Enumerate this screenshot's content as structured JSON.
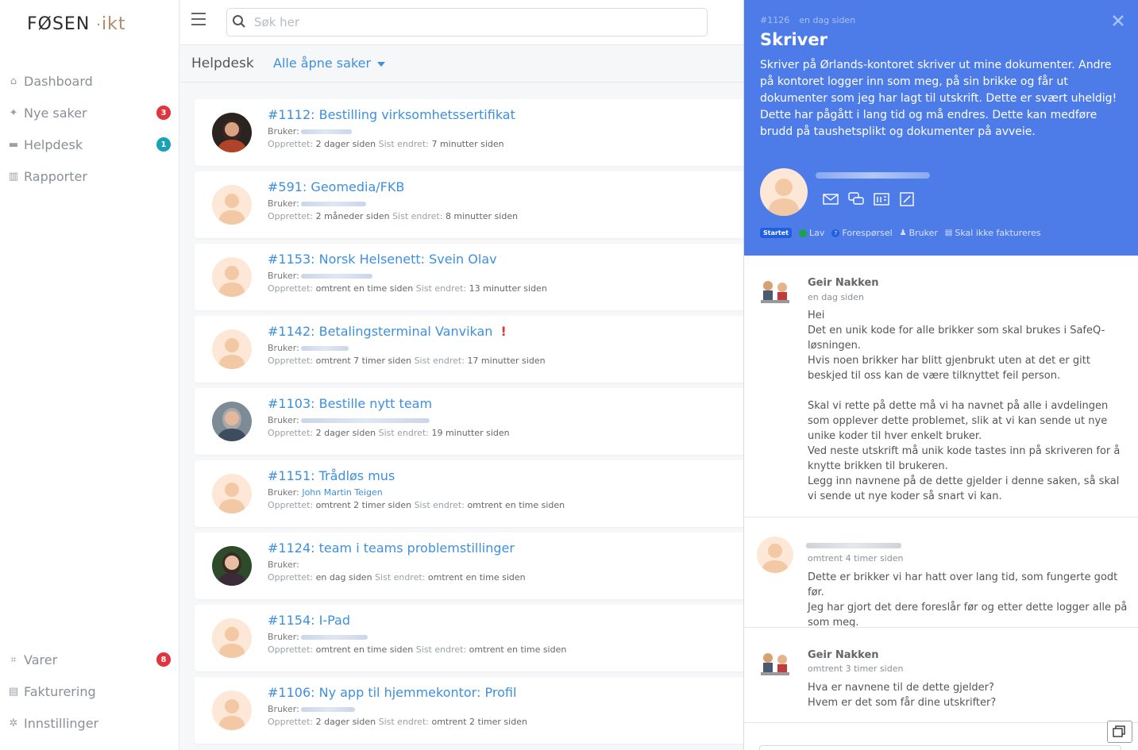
{
  "app": {
    "logo_main": "FØSEN",
    "logo_suffix": "ikt"
  },
  "sidebar": {
    "items": [
      {
        "label": "Dashboard",
        "icon": "home-icon"
      },
      {
        "label": "Nye saker",
        "icon": "sparkle-icon",
        "badge": "3",
        "badge_color": "#e0343f"
      },
      {
        "label": "Helpdesk",
        "icon": "monitor-icon",
        "badge": "1",
        "badge_color": "#17a2b8"
      },
      {
        "label": "Rapporter",
        "icon": "chart-icon"
      }
    ],
    "bottom_items": [
      {
        "label": "Varer",
        "icon": "gift-icon",
        "badge": "8",
        "badge_color": "#e0343f"
      },
      {
        "label": "Fakturering",
        "icon": "invoice-icon"
      },
      {
        "label": "Innstillinger",
        "icon": "gear-icon"
      }
    ]
  },
  "search": {
    "placeholder": "Søk her"
  },
  "subheader": {
    "title": "Helpdesk",
    "filter": "Alle åpne saker"
  },
  "tickets": [
    {
      "title": "#1112: Bestilling virksomhetssertifikat",
      "user_label": "Bruker:",
      "created_label": "Opprettet:",
      "created": "2 dager siden",
      "changed_label": "Sist endret:",
      "changed": "7 minutter siden",
      "avatar": "photo"
    },
    {
      "title": "#591: Geomedia/FKB",
      "user_label": "Bruker:",
      "created_label": "Opprettet:",
      "created": "2 måneder siden",
      "changed_label": "Sist endret:",
      "changed": "8 minutter siden",
      "avatar": "placeholder"
    },
    {
      "title": "#1153: Norsk Helsenett: Svein Olav",
      "user_label": "Bruker:",
      "created_label": "Opprettet:",
      "created": "omtrent en time siden",
      "changed_label": "Sist endret:",
      "changed": "13 minutter siden",
      "avatar": "placeholder"
    },
    {
      "title": "#1142: Betalingsterminal Vanvikan",
      "user_label": "Bruker:",
      "created_label": "Opprettet:",
      "created": "omtrent 7 timer siden",
      "changed_label": "Sist endret:",
      "changed": "17 minutter siden",
      "avatar": "placeholder",
      "warning": "!"
    },
    {
      "title": "#1103: Bestille nytt team",
      "user_label": "Bruker:",
      "created_label": "Opprettet:",
      "created": "2 dager siden",
      "changed_label": "Sist endret:",
      "changed": "19 minutter siden",
      "avatar": "photo"
    },
    {
      "title": "#1151: Trådløs mus",
      "user_label": "Bruker:",
      "user_name": "John Martin Teigen",
      "created_label": "Opprettet:",
      "created": "omtrent 2 timer siden",
      "changed_label": "Sist endret:",
      "changed": "omtrent en time siden",
      "avatar": "placeholder"
    },
    {
      "title": "#1124: team i teams problemstillinger",
      "user_label": "Bruker:",
      "created_label": "Opprettet:",
      "created": "en dag siden",
      "changed_label": "Sist endret:",
      "changed": "omtrent en time siden",
      "avatar": "photo"
    },
    {
      "title": "#1154: I-Pad",
      "user_label": "Bruker:",
      "created_label": "Opprettet:",
      "created": "omtrent en time siden",
      "changed_label": "Sist endret:",
      "changed": "omtrent en time siden",
      "avatar": "placeholder"
    },
    {
      "title": "#1106: Ny app til hjemmekontor: Profil",
      "user_label": "Bruker:",
      "created_label": "Opprettet:",
      "created": "2 dager siden",
      "changed_label": "Sist endret:",
      "changed": "omtrent 2 timer siden",
      "avatar": "placeholder"
    }
  ],
  "detail": {
    "id": "#1126",
    "age": "en dag siden",
    "title": "Skriver",
    "description": "Skriver på Ørlands-kontoret skriver ut mine dokumenter. Andre på kontoret logger inn som meg, på sin brikke og får ut dokumenter som jeg har lagt til utskrift. Dette er svært uheldig! Dette har pågått i lang tid og må endres. Dette kan medføre brudd på taushetsplikt og dokumenter på avveie.",
    "status": "Startet",
    "priority": "Lav",
    "type": "Forespørsel",
    "role": "Bruker",
    "billing": "Skal ikke faktureres",
    "accent_color": "#4d7ce8"
  },
  "comments": [
    {
      "author": "Geir Nakken",
      "time": "en dag siden",
      "body": "Hei\nDet en unik kode for alle brikker som skal brukes i SafeQ-løsningen.\nHvis noen brikker har blitt gjenbrukt uten at det er gitt beskjed til oss kan de være tilknyttet feil person.\n\nSkal vi rette på dette må vi ha navnet på alle i avdelingen som opplever dette problemet, slik at vi kan sende ut nye unike koder til hver enkelt bruker.\nVed neste utskrift må unik kode tastes inn på skriveren for å knytte brikken til brukeren.\nLegg inn navnene på de dette gjelder i denne saken, så skal vi sende ut nye koder så snart vi kan."
    },
    {
      "author": "",
      "time": "omtrent 4 timer siden",
      "body": "Dette er brikker vi har hatt over lang tid, som fungerte godt før.\nJeg har gjort det dere foreslår før og etter dette logger alle på som meg."
    },
    {
      "author": "Geir Nakken",
      "time": "omtrent 3 timer siden",
      "body": "Hva er navnene til de dette gjelder?\nHvem er det som får dine utskrifter?"
    }
  ]
}
